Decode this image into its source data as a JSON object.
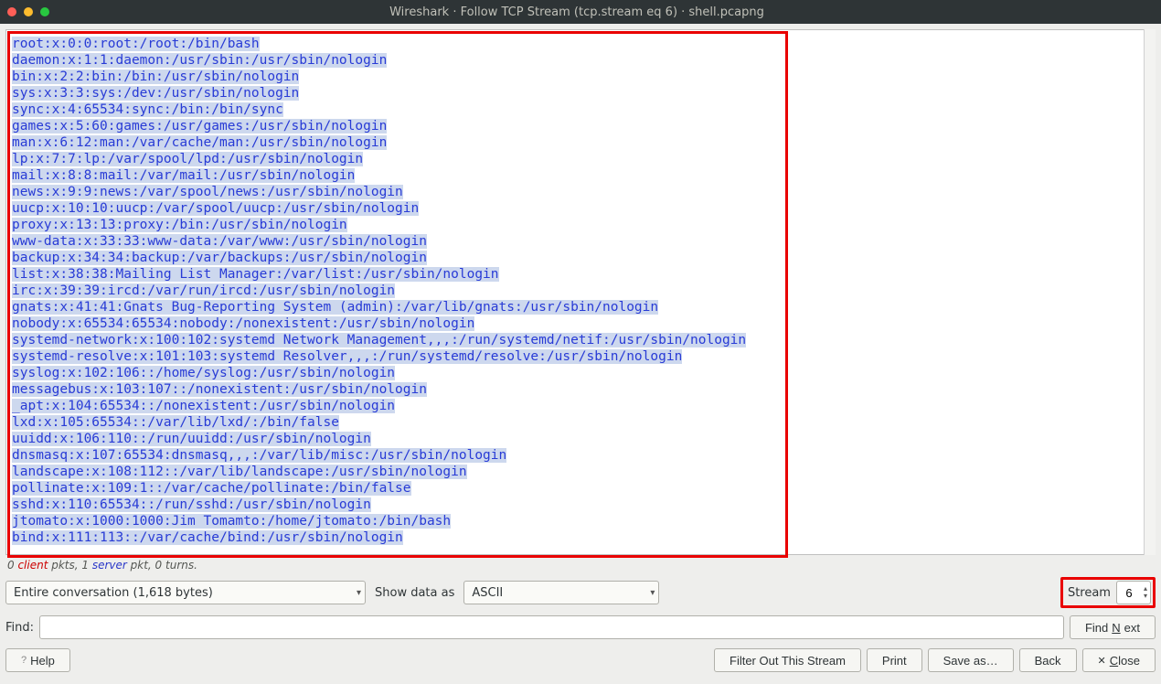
{
  "window": {
    "title": "Wireshark · Follow TCP Stream (tcp.stream eq 6) · shell.pcapng"
  },
  "stream": {
    "lines": [
      "root:x:0:0:root:/root:/bin/bash",
      "daemon:x:1:1:daemon:/usr/sbin:/usr/sbin/nologin",
      "bin:x:2:2:bin:/bin:/usr/sbin/nologin",
      "sys:x:3:3:sys:/dev:/usr/sbin/nologin",
      "sync:x:4:65534:sync:/bin:/bin/sync",
      "games:x:5:60:games:/usr/games:/usr/sbin/nologin",
      "man:x:6:12:man:/var/cache/man:/usr/sbin/nologin",
      "lp:x:7:7:lp:/var/spool/lpd:/usr/sbin/nologin",
      "mail:x:8:8:mail:/var/mail:/usr/sbin/nologin",
      "news:x:9:9:news:/var/spool/news:/usr/sbin/nologin",
      "uucp:x:10:10:uucp:/var/spool/uucp:/usr/sbin/nologin",
      "proxy:x:13:13:proxy:/bin:/usr/sbin/nologin",
      "www-data:x:33:33:www-data:/var/www:/usr/sbin/nologin",
      "backup:x:34:34:backup:/var/backups:/usr/sbin/nologin",
      "list:x:38:38:Mailing List Manager:/var/list:/usr/sbin/nologin",
      "irc:x:39:39:ircd:/var/run/ircd:/usr/sbin/nologin",
      "gnats:x:41:41:Gnats Bug-Reporting System (admin):/var/lib/gnats:/usr/sbin/nologin",
      "nobody:x:65534:65534:nobody:/nonexistent:/usr/sbin/nologin",
      "systemd-network:x:100:102:systemd Network Management,,,:/run/systemd/netif:/usr/sbin/nologin",
      "systemd-resolve:x:101:103:systemd Resolver,,,:/run/systemd/resolve:/usr/sbin/nologin",
      "syslog:x:102:106::/home/syslog:/usr/sbin/nologin",
      "messagebus:x:103:107::/nonexistent:/usr/sbin/nologin",
      "_apt:x:104:65534::/nonexistent:/usr/sbin/nologin",
      "lxd:x:105:65534::/var/lib/lxd/:/bin/false",
      "uuidd:x:106:110::/run/uuidd:/usr/sbin/nologin",
      "dnsmasq:x:107:65534:dnsmasq,,,:/var/lib/misc:/usr/sbin/nologin",
      "landscape:x:108:112::/var/lib/landscape:/usr/sbin/nologin",
      "pollinate:x:109:1::/var/cache/pollinate:/bin/false",
      "sshd:x:110:65534::/run/sshd:/usr/sbin/nologin",
      "jtomato:x:1000:1000:Jim Tomamto:/home/jtomato:/bin/bash",
      "bind:x:111:113::/var/cache/bind:/usr/sbin/nologin"
    ]
  },
  "info": {
    "text_pre": "0 ",
    "client": "client",
    "mid": " pkts, 1 ",
    "server": "server",
    "post": " pkt, 0 turns."
  },
  "controls": {
    "conversation": "Entire conversation (1,618 bytes)",
    "show_data_label": "Show data as",
    "encoding": "ASCII",
    "stream_label": "Stream",
    "stream_number": "6"
  },
  "find": {
    "label": "Find:",
    "next_pre": "Find ",
    "next_u": "N",
    "next_post": "ext"
  },
  "buttons": {
    "help": "Help",
    "filter_out": "Filter Out This Stream",
    "print": "Print",
    "save_as": "Save as…",
    "back": "Back",
    "close_u": "C",
    "close_post": "lose"
  }
}
